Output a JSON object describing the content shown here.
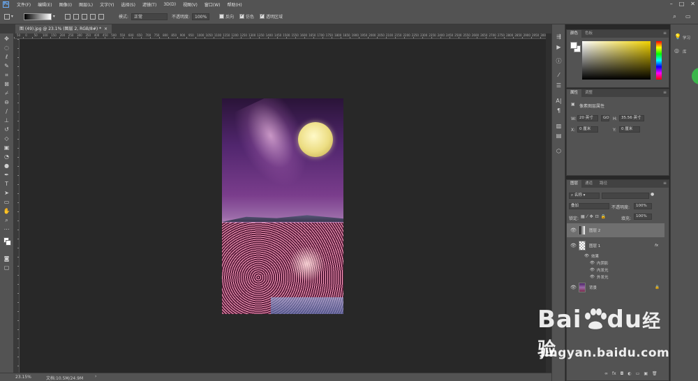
{
  "menubar": {
    "logo": "Ps",
    "items": [
      "文件(F)",
      "编辑(E)",
      "图像(I)",
      "图层(L)",
      "文字(Y)",
      "选择(S)",
      "滤镜(T)",
      "3D(D)",
      "视图(V)",
      "窗口(W)",
      "帮助(H)"
    ]
  },
  "options": {
    "mode_label": "模式:",
    "mode_value": "正常",
    "opacity_label": "不透明度:",
    "opacity_value": "100%",
    "reverse_label": "反向",
    "dither_label": "仿色",
    "transparency_label": "透明区域"
  },
  "document": {
    "tab_title": "图 (49).jpg @ 23.1% (图层 2, RGB/8#) *",
    "tab_close": "×"
  },
  "ruler_h_labels": [
    "50",
    "0",
    "50",
    "100",
    "150",
    "200",
    "250",
    "300",
    "350",
    "400",
    "450",
    "500",
    "550",
    "600",
    "650",
    "700",
    "750",
    "800",
    "850",
    "900",
    "950",
    "1000",
    "1050",
    "1100",
    "1150",
    "1200",
    "1250",
    "1300",
    "1350",
    "1400",
    "1450",
    "1500",
    "1550",
    "1600",
    "1650",
    "1700",
    "1750",
    "1800",
    "1850",
    "1900",
    "1950",
    "2000",
    "2050",
    "2100",
    "2150",
    "2200",
    "2250",
    "2300",
    "2350",
    "2400",
    "2450",
    "2500",
    "2550",
    "2600",
    "2650",
    "2700",
    "2750",
    "2800",
    "2850",
    "2900",
    "2950",
    "3000"
  ],
  "statusbar": {
    "zoom": "23.15%",
    "doc_info": "文档:10.5M/24.9M",
    "arrow": "›"
  },
  "color_panel": {
    "tabs": [
      "颜色",
      "色板"
    ],
    "fg_color": "#ffffff",
    "bg_color": "#ffffff"
  },
  "props_panel": {
    "tabs": [
      "属性",
      "调整"
    ],
    "heading": "像素图层属性",
    "w_label": "W:",
    "w_value": "20 英寸",
    "link_icon": "GO",
    "h_label": "H:",
    "h_value": "35.56 英寸",
    "x_label": "X:",
    "x_value": "0 厘米",
    "y_label": "Y:",
    "y_value": "0 厘米"
  },
  "layers_panel": {
    "tabs": [
      "图层",
      "通道",
      "路径"
    ],
    "filter_label": "名称",
    "blend_mode": "叠加",
    "opacity_label": "不透明度:",
    "opacity_value": "100%",
    "lock_label": "锁定:",
    "fill_label": "填充:",
    "fill_value": "100%",
    "layers": [
      {
        "name": "图层 2",
        "selected": true
      },
      {
        "name": "图层 1",
        "fx": "fx"
      },
      {
        "name": "背景",
        "locked": true
      }
    ],
    "effects_label": "效果",
    "effects": [
      "内阴影",
      "内发光",
      "外发光"
    ],
    "bottom_icons": [
      "∞",
      "fx",
      "◘",
      "◐",
      "▭",
      "▣",
      "🗑"
    ]
  },
  "farright": {
    "learn_label": "学习",
    "library_label": "库"
  },
  "watermark": {
    "brand": "Bai",
    "brand2": "du",
    "cn": "经验",
    "site": "jingyan.baidu.com"
  }
}
